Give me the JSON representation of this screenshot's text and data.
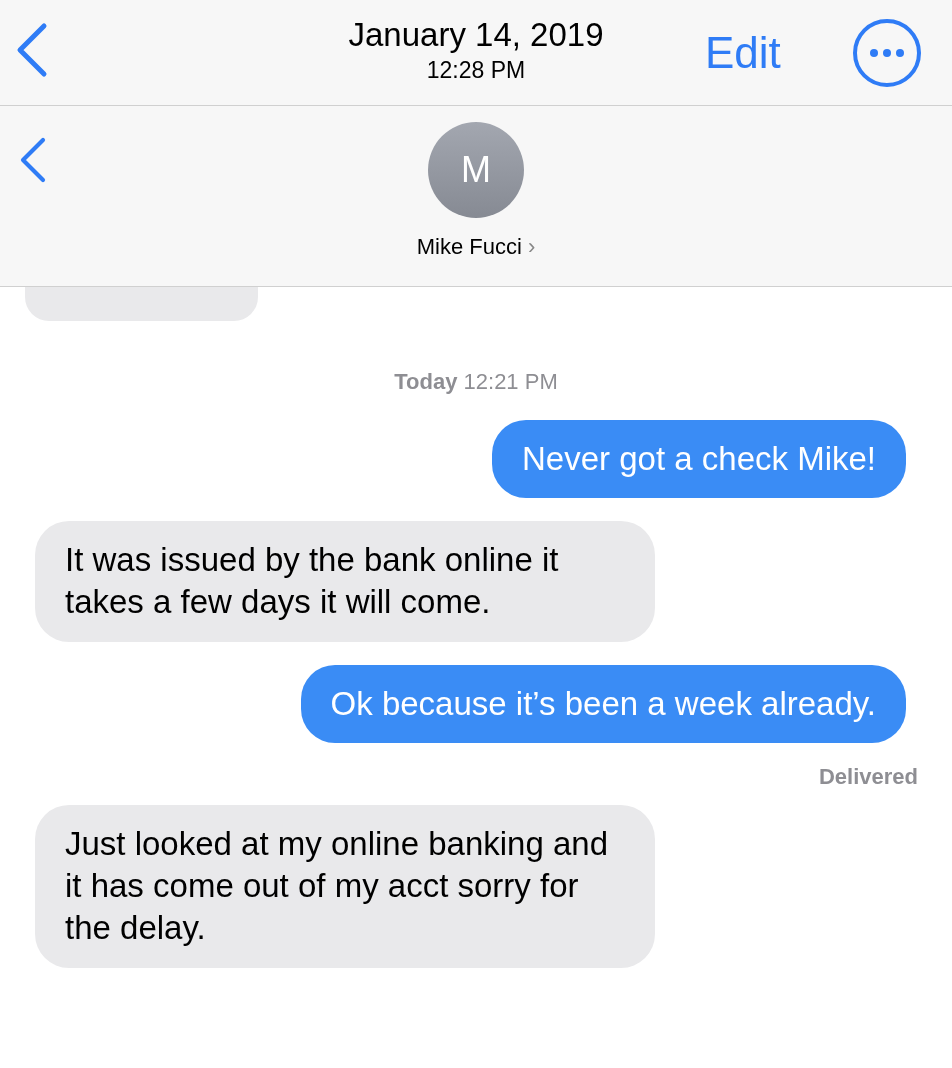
{
  "top_bar": {
    "date": "January 14, 2019",
    "time": "12:28 PM",
    "edit": "Edit"
  },
  "contact": {
    "initial": "M",
    "name": "Mike Fucci",
    "chevron": "›"
  },
  "timestamp": "**Today** 12:21 PM",
  "messages": [
    {
      "kind": "sent",
      "text": "Never got a check Mike!"
    },
    {
      "kind": "received",
      "text": "It was issued by the bank online it takes a few days it will come."
    },
    {
      "kind": "sent",
      "text": "Ok because it’s been a week already.",
      "status": "Delivered"
    },
    {
      "kind": "received",
      "text": "Just looked at my online banking and it has come out of my acct sorry for the delay."
    }
  ]
}
